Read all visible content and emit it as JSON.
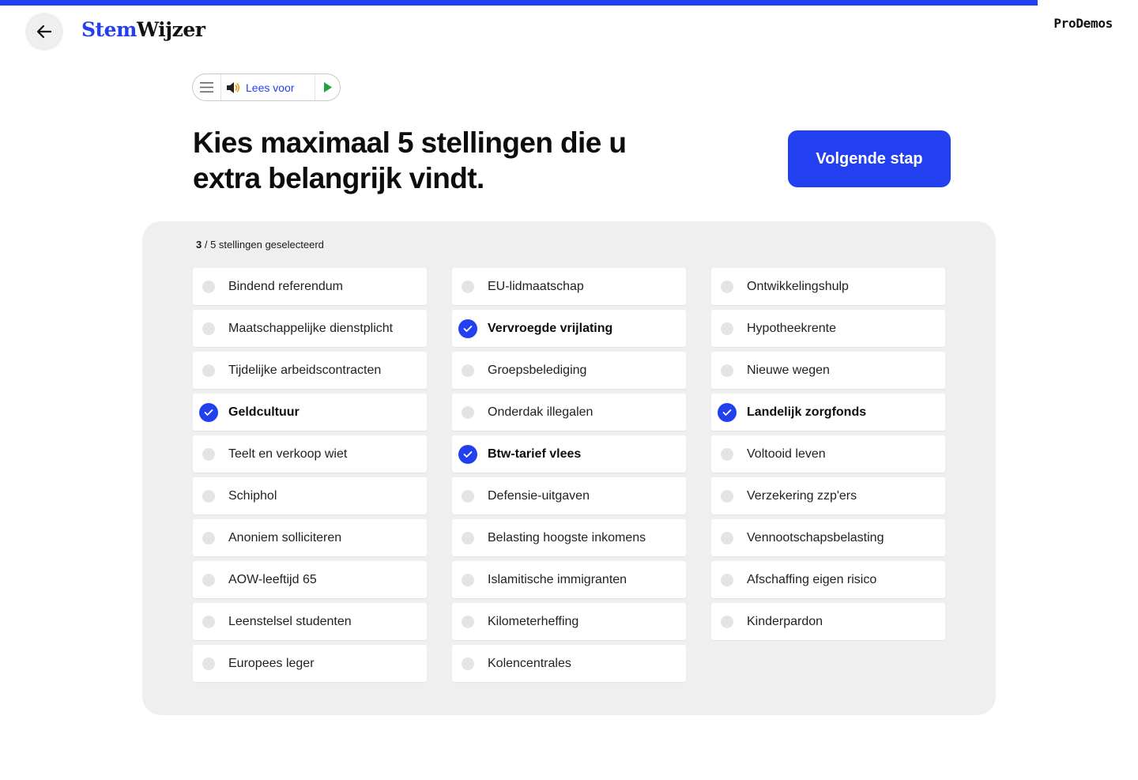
{
  "progress": {
    "fraction": 0.912,
    "color": "#2340f0"
  },
  "header": {
    "logo_part1": "Stem",
    "logo_part2": "Wijzer",
    "partner": "ProDemos"
  },
  "readspeaker": {
    "label": "Lees voor"
  },
  "page": {
    "heading_line1": "Kies maximaal 5 stellingen die u",
    "heading_line2": "extra belangrijk vindt.",
    "next_button": "Volgende stap"
  },
  "counter": {
    "selected": "3",
    "text": " / 5 stellingen geselecteerd"
  },
  "columns": [
    [
      {
        "label": "Bindend referendum",
        "checked": false
      },
      {
        "label": "Maatschappelijke dienstplicht",
        "checked": false
      },
      {
        "label": "Tijdelijke arbeidscontracten",
        "checked": false
      },
      {
        "label": "Geldcultuur",
        "checked": true
      },
      {
        "label": "Teelt en verkoop wiet",
        "checked": false
      },
      {
        "label": "Schiphol",
        "checked": false
      },
      {
        "label": "Anoniem solliciteren",
        "checked": false
      },
      {
        "label": "AOW-leeftijd 65",
        "checked": false
      },
      {
        "label": "Leenstelsel studenten",
        "checked": false
      },
      {
        "label": "Europees leger",
        "checked": false
      }
    ],
    [
      {
        "label": "EU-lidmaatschap",
        "checked": false
      },
      {
        "label": "Vervroegde vrijlating",
        "checked": true
      },
      {
        "label": "Groepsbelediging",
        "checked": false
      },
      {
        "label": "Onderdak illegalen",
        "checked": false
      },
      {
        "label": "Btw-tarief vlees",
        "checked": true
      },
      {
        "label": "Defensie-uitgaven",
        "checked": false
      },
      {
        "label": "Belasting hoogste inkomens",
        "checked": false
      },
      {
        "label": "Islamitische immigranten",
        "checked": false
      },
      {
        "label": "Kilometerheffing",
        "checked": false
      },
      {
        "label": "Kolencentrales",
        "checked": false
      }
    ],
    [
      {
        "label": "Ontwikkelingshulp",
        "checked": false
      },
      {
        "label": "Hypotheekrente",
        "checked": false
      },
      {
        "label": "Nieuwe wegen",
        "checked": false
      },
      {
        "label": "Landelijk zorgfonds",
        "checked": true
      },
      {
        "label": "Voltooid leven",
        "checked": false
      },
      {
        "label": "Verzekering zzp'ers",
        "checked": false
      },
      {
        "label": "Vennootschapsbelasting",
        "checked": false
      },
      {
        "label": "Afschaffing eigen risico",
        "checked": false
      },
      {
        "label": "Kinderpardon",
        "checked": false
      }
    ]
  ],
  "icons": {
    "back": "arrow-left-icon",
    "menu": "hamburger-icon",
    "speaker": "speaker-icon",
    "play": "play-icon",
    "check": "checkmark-icon"
  }
}
